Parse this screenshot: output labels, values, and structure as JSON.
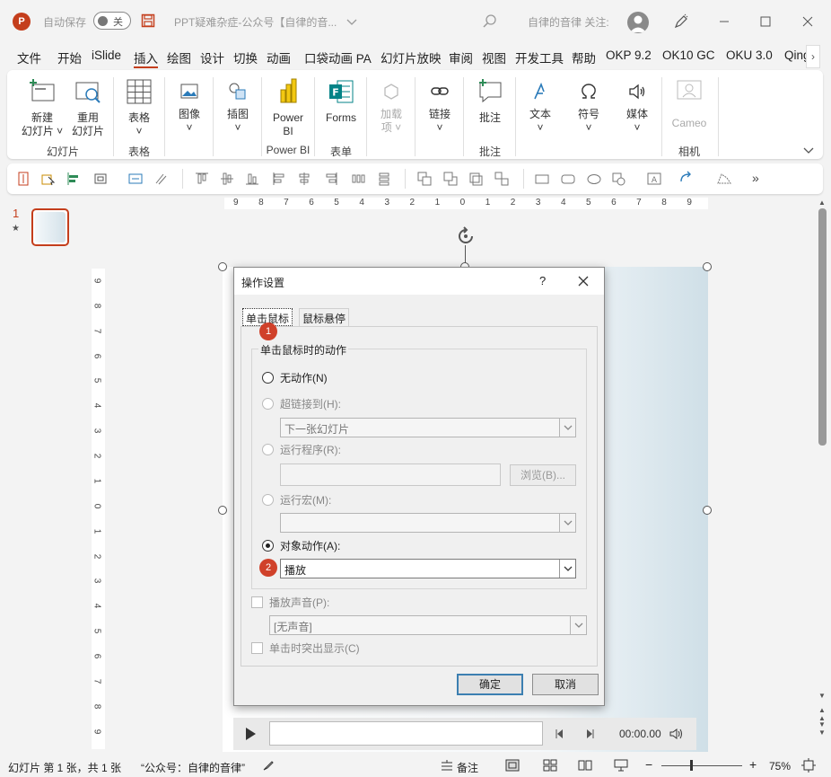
{
  "titlebar": {
    "logo_letter": "P",
    "autosave_label": "自动保存",
    "autosave_state": "关",
    "doc_title": "PPT疑难杂症-公众号【自律的音...",
    "author": "自律的音律 关注:",
    "icons": [
      "powerpoint-logo",
      "save-icon",
      "chevron-down-icon",
      "search-icon",
      "user-avatar",
      "pen-icon",
      "minimize-icon",
      "maximize-icon",
      "close-icon"
    ]
  },
  "menu": {
    "tabs": [
      "文件",
      "开始",
      "iSlide",
      "插入",
      "绘图",
      "设计",
      "切换",
      "动画",
      "口袋动画 PA",
      "幻灯片放映",
      "审阅",
      "视图",
      "开发工具",
      "帮助",
      "OKP 9.2",
      "OK10 GC",
      "OKU 3.0",
      "Qing"
    ],
    "active_tab": "插入"
  },
  "ribbon": {
    "buttons": [
      {
        "label": "新建\n幻灯片 ˅"
      },
      {
        "label": "重用\n幻灯片"
      },
      {
        "label": "表格\n˅"
      },
      {
        "label": "图像\n˅"
      },
      {
        "label": "插图\n˅"
      },
      {
        "label": "Power\nBI"
      },
      {
        "label": "Forms"
      },
      {
        "label": "加载\n项 ˅"
      },
      {
        "label": "链接\n˅"
      },
      {
        "label": "批注"
      },
      {
        "label": "文本\n˅"
      },
      {
        "label": "符号\n˅"
      },
      {
        "label": "媒体\n˅"
      },
      {
        "label": "Cameo"
      }
    ],
    "groups": [
      "幻灯片",
      "表格",
      "Power BI",
      "表单",
      "批注",
      "相机"
    ]
  },
  "qat": {
    "more": "»"
  },
  "thumbnails": {
    "number": "1",
    "star": "★"
  },
  "ruler": {
    "h_ticks": [
      "9",
      "8",
      "7",
      "6",
      "5",
      "4",
      "3",
      "2",
      "1",
      "0",
      "1",
      "2",
      "3",
      "4",
      "5",
      "6",
      "7",
      "8",
      "9"
    ],
    "v_ticks": [
      "9",
      "8",
      "7",
      "6",
      "5",
      "4",
      "3",
      "2",
      "1",
      "0",
      "1",
      "2",
      "3",
      "4",
      "5",
      "6",
      "7",
      "8",
      "9"
    ]
  },
  "media": {
    "time": "00:00.00"
  },
  "dialog": {
    "title": "操作设置",
    "help": "?",
    "tabs": [
      "单击鼠标",
      "鼠标悬停"
    ],
    "group_label": "单击鼠标时的动作",
    "options": {
      "none": "无动作(N)",
      "hyperlink": "超链接到(H):",
      "hyperlink_value": "下一张幻灯片",
      "run_program": "运行程序(R):",
      "browse": "浏览(B)...",
      "run_macro": "运行宏(M):",
      "object_action": "对象动作(A):",
      "object_action_value": "播放"
    },
    "play_sound": "播放声音(P):",
    "sound_value": "[无声音]",
    "highlight": "单击时突出显示(C)",
    "ok": "确定",
    "cancel": "取消",
    "badges": [
      "1",
      "2"
    ]
  },
  "status": {
    "slide_info": "幻灯片 第 1 张，共 1 张",
    "theme": "“公众号：自律的音律”",
    "notes": "备注",
    "zoom": "75%",
    "zoom_level": 75
  }
}
